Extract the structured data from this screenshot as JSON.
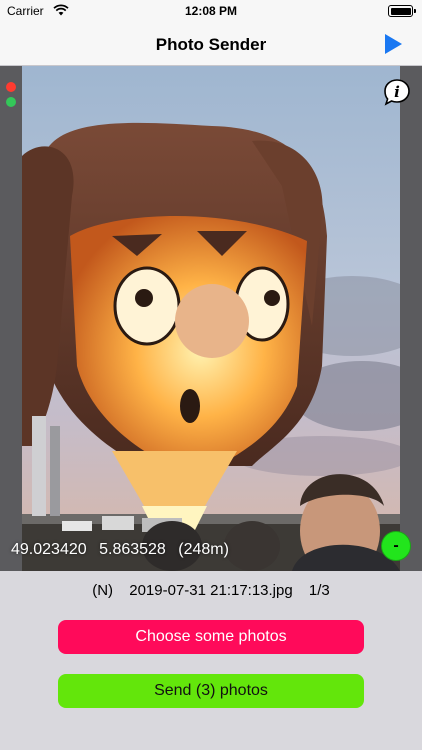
{
  "status_bar": {
    "carrier": "Carrier",
    "time": "12:08 PM"
  },
  "nav": {
    "title": "Photo Sender",
    "play_icon": "play-icon",
    "accent_color": "#1a78f2"
  },
  "photo": {
    "indicators": [
      {
        "name": "red-indicator",
        "color": "#ff3b30"
      },
      {
        "name": "green-indicator",
        "color": "#34c759"
      }
    ],
    "info_icon": "info-bubble-icon",
    "latitude": "49.023420",
    "longitude": "5.863528",
    "altitude": "(248m)",
    "remove_label": "-"
  },
  "file": {
    "flag": "(N)",
    "filename": "2019-07-31 21:17:13.jpg",
    "position": "1/3"
  },
  "actions": {
    "choose_label": "Choose some photos",
    "send_label": "Send (3) photos",
    "choose_color": "#ff0a5a",
    "send_color": "#63e60b"
  }
}
